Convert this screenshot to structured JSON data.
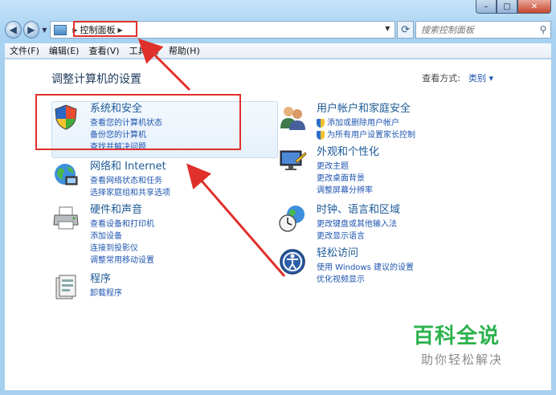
{
  "window": {
    "caption": {
      "minimize": "–",
      "maximize": "□",
      "close": "✕"
    }
  },
  "navbar": {
    "address_crumb": "控制面板",
    "search_placeholder": "搜索控制面板"
  },
  "menubar": [
    "文件(F)",
    "编辑(E)",
    "查看(V)",
    "工具(T)",
    "帮助(H)"
  ],
  "page": {
    "title": "调整计算机的设置",
    "view_by_label": "查看方式:",
    "view_by_value": "类别 ▾"
  },
  "categories_left": [
    {
      "title": "系统和安全",
      "icon": "shield-icon",
      "links": [
        "查看您的计算机状态",
        "备份您的计算机",
        "查找并解决问题"
      ]
    },
    {
      "title": "网络和 Internet",
      "icon": "network-icon",
      "links": [
        "查看网络状态和任务",
        "选择家庭组和共享选项"
      ]
    },
    {
      "title": "硬件和声音",
      "icon": "printer-icon",
      "links": [
        "查看设备和打印机",
        "添加设备",
        "连接到投影仪",
        "调整常用移动设置"
      ]
    },
    {
      "title": "程序",
      "icon": "programs-icon",
      "links": [
        "卸载程序"
      ]
    }
  ],
  "categories_right": [
    {
      "title": "用户帐户和家庭安全",
      "icon": "users-icon",
      "links": [
        "添加或删除用户帐户",
        "为所有用户设置家长控制"
      ]
    },
    {
      "title": "外观和个性化",
      "icon": "monitor-icon",
      "links": [
        "更改主题",
        "更改桌面背景",
        "调整屏幕分辨率"
      ]
    },
    {
      "title": "时钟、语言和区域",
      "icon": "clock-globe-icon",
      "links": [
        "更改键盘或其他输入法",
        "更改显示语言"
      ]
    },
    {
      "title": "轻松访问",
      "icon": "ease-of-access-icon",
      "links": [
        "使用 Windows 建议的设置",
        "优化视频显示"
      ]
    }
  ],
  "watermark": {
    "title": "百科全说",
    "subtitle": "助你轻松解决"
  },
  "colors": {
    "accent_link": "#1f55b0",
    "highlight_red": "#e0302b",
    "watermark_green": "#2bb24c"
  }
}
